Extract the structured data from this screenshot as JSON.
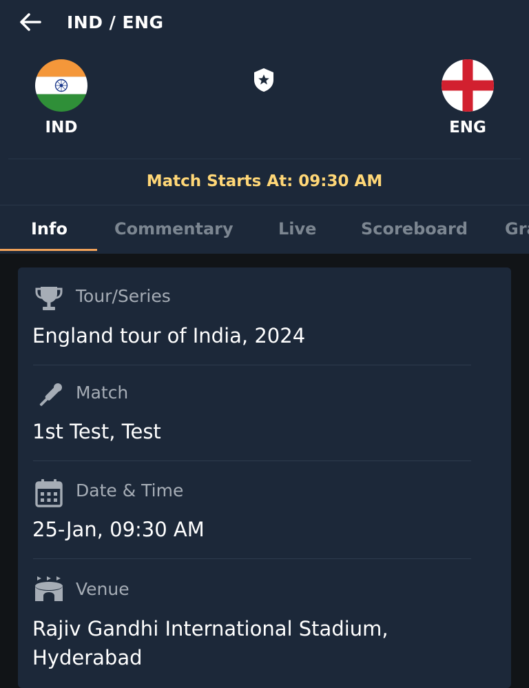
{
  "header": {
    "title": "IND / ENG",
    "match_start": "Match Starts At: 09:30 AM"
  },
  "teams": {
    "home": {
      "code": "IND",
      "flag_icon": "india-flag-icon"
    },
    "away": {
      "code": "ENG",
      "flag_icon": "england-flag-icon"
    }
  },
  "tabs": [
    {
      "label": "Info",
      "active": true
    },
    {
      "label": "Commentary",
      "active": false
    },
    {
      "label": "Live",
      "active": false
    },
    {
      "label": "Scoreboard",
      "active": false
    },
    {
      "label": "Gra",
      "active": false
    }
  ],
  "info": {
    "series": {
      "icon": "trophy-icon",
      "label": "Tour/Series",
      "value": "England tour of India, 2024"
    },
    "match": {
      "icon": "cricket-bat-icon",
      "label": "Match",
      "value": "1st Test, Test"
    },
    "datetime": {
      "icon": "calendar-icon",
      "label": "Date & Time",
      "value": "25-Jan, 09:30 AM"
    },
    "venue": {
      "icon": "stadium-icon",
      "label": "Venue",
      "value": "Rajiv Gandhi International Stadium, Hyderabad"
    }
  },
  "colors": {
    "header_bg": "#1c2839",
    "page_bg": "#111417",
    "accent": "#f2a35a",
    "match_start_text": "#ffd777",
    "inactive_tab": "#7c8691"
  }
}
